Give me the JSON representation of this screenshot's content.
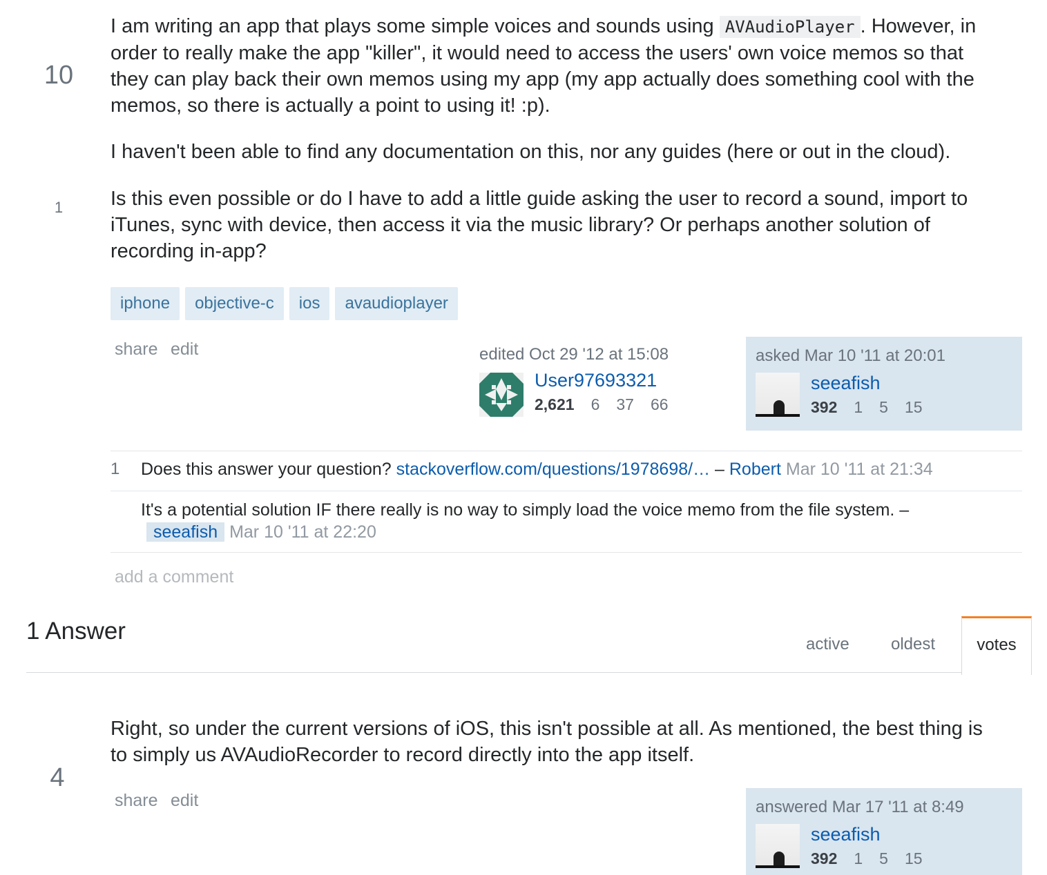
{
  "question": {
    "vote_count": "10",
    "favorite_count": "1",
    "p1_before": "I am writing an app that plays some simple voices and sounds using ",
    "p1_code": "AVAudioPlayer",
    "p1_line1_after": ". However, in",
    "p1_line2": "order to really make the app \"killer\", it would need to access the users' own voice memos so that",
    "p1_line3": "they can play back their own memos using my app (my app actually does something cool with the",
    "p1_line4": "memos, so there is actually a point to using it! :p).",
    "p2": "I haven't been able to find any documentation on this, nor any guides (here or out in the cloud).",
    "p3_line1": "Is this even possible or do I have to add a little guide asking the user to record a sound, import to",
    "p3_line2": "iTunes, sync with device, then access it via the music library? Or perhaps another solution of",
    "p3_line3": "recording in-app?",
    "tags": [
      "iphone",
      "objective-c",
      "ios",
      "avaudioplayer"
    ],
    "share_label": "share",
    "edit_label": "edit",
    "edited": {
      "label": "edited Oct 29 '12 at 15:08",
      "user": "User97693321",
      "reputation": "2,621",
      "gold": "6",
      "silver": "37",
      "bronze": "66"
    },
    "asked": {
      "label": "asked Mar 10 '11 at 20:01",
      "user": "seeafish",
      "reputation": "392",
      "gold": "1",
      "silver": "5",
      "bronze": "15"
    },
    "comments": [
      {
        "score": "1",
        "text": "Does this answer your question? ",
        "link": "stackoverflow.com/questions/1978698/…",
        "dash": " – ",
        "user": "Robert",
        "time": "Mar 10 '11 at 21:34"
      },
      {
        "score": "",
        "text": "It's a potential solution IF there really is no way to simply load the voice memo from the file system. –",
        "user": "seeafish",
        "time": "Mar 10 '11 at 22:20"
      }
    ],
    "add_comment": "add a comment"
  },
  "answers_header": {
    "count_label": "1 Answer",
    "tabs": [
      "active",
      "oldest",
      "votes"
    ],
    "active_tab": "votes"
  },
  "answer": {
    "vote_count": "4",
    "line1": "Right, so under the current versions of iOS, this isn't possible at all. As mentioned, the best thing is",
    "line2": "to simply us AVAudioRecorder to record directly into the app itself.",
    "share_label": "share",
    "edit_label": "edit",
    "answered": {
      "label": "answered Mar 17 '11 at 8:49",
      "user": "seeafish",
      "reputation": "392",
      "gold": "1",
      "silver": "5",
      "bronze": "15"
    }
  },
  "colors": {
    "link": "#0c5cad",
    "tag_bg": "#e1ecf4",
    "tag_text": "#39739d",
    "owner_card_bg": "#d9e5ef",
    "tab_accent": "#f48024"
  }
}
